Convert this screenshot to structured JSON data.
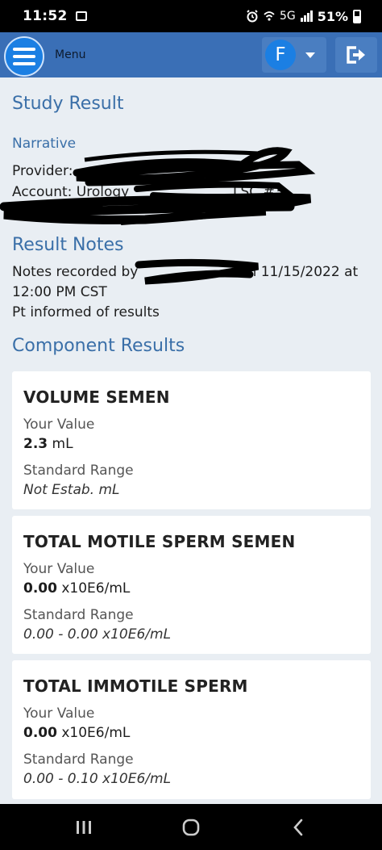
{
  "status_bar": {
    "time": "11:52",
    "network": "5G",
    "battery": "51%",
    "icons": [
      "gallery-icon",
      "alarm-icon",
      "wifi-icon",
      "signal-icon",
      "battery-icon"
    ]
  },
  "app_bar": {
    "menu_label": "Menu",
    "user_initial": "F",
    "colors": {
      "bar": "#3a6fb6",
      "accent": "#1b7fe3"
    }
  },
  "study": {
    "title": "Study Result",
    "narrative_label": "Narrative",
    "provider_prefix": "Provider: ",
    "account_prefix": "Account: Urology",
    "account_suffix": "LSC #3"
  },
  "result_notes": {
    "title": "Result Notes",
    "notes_prefix": "Notes recorded by",
    "notes_suffix": "on 11/15/2022 at",
    "notes_line2": "12:00 PM CST",
    "informed": "Pt informed of results"
  },
  "component_results": {
    "title": "Component Results",
    "your_value_label": "Your Value",
    "standard_range_label": "Standard Range",
    "items": [
      {
        "name": "VOLUME SEMEN",
        "value": "2.3",
        "unit": " mL",
        "range": "Not Estab. mL"
      },
      {
        "name": "TOTAL MOTILE SPERM SEMEN",
        "value": "0.00",
        "unit": " x10E6/mL",
        "range": "0.00 - 0.00 x10E6/mL"
      },
      {
        "name": "TOTAL IMMOTILE SPERM",
        "value": "0.00",
        "unit": " x10E6/mL",
        "range": "0.00 - 0.10 x10E6/mL"
      }
    ]
  },
  "nav_bar": {
    "buttons": [
      "recents-button",
      "home-button",
      "back-button"
    ]
  }
}
